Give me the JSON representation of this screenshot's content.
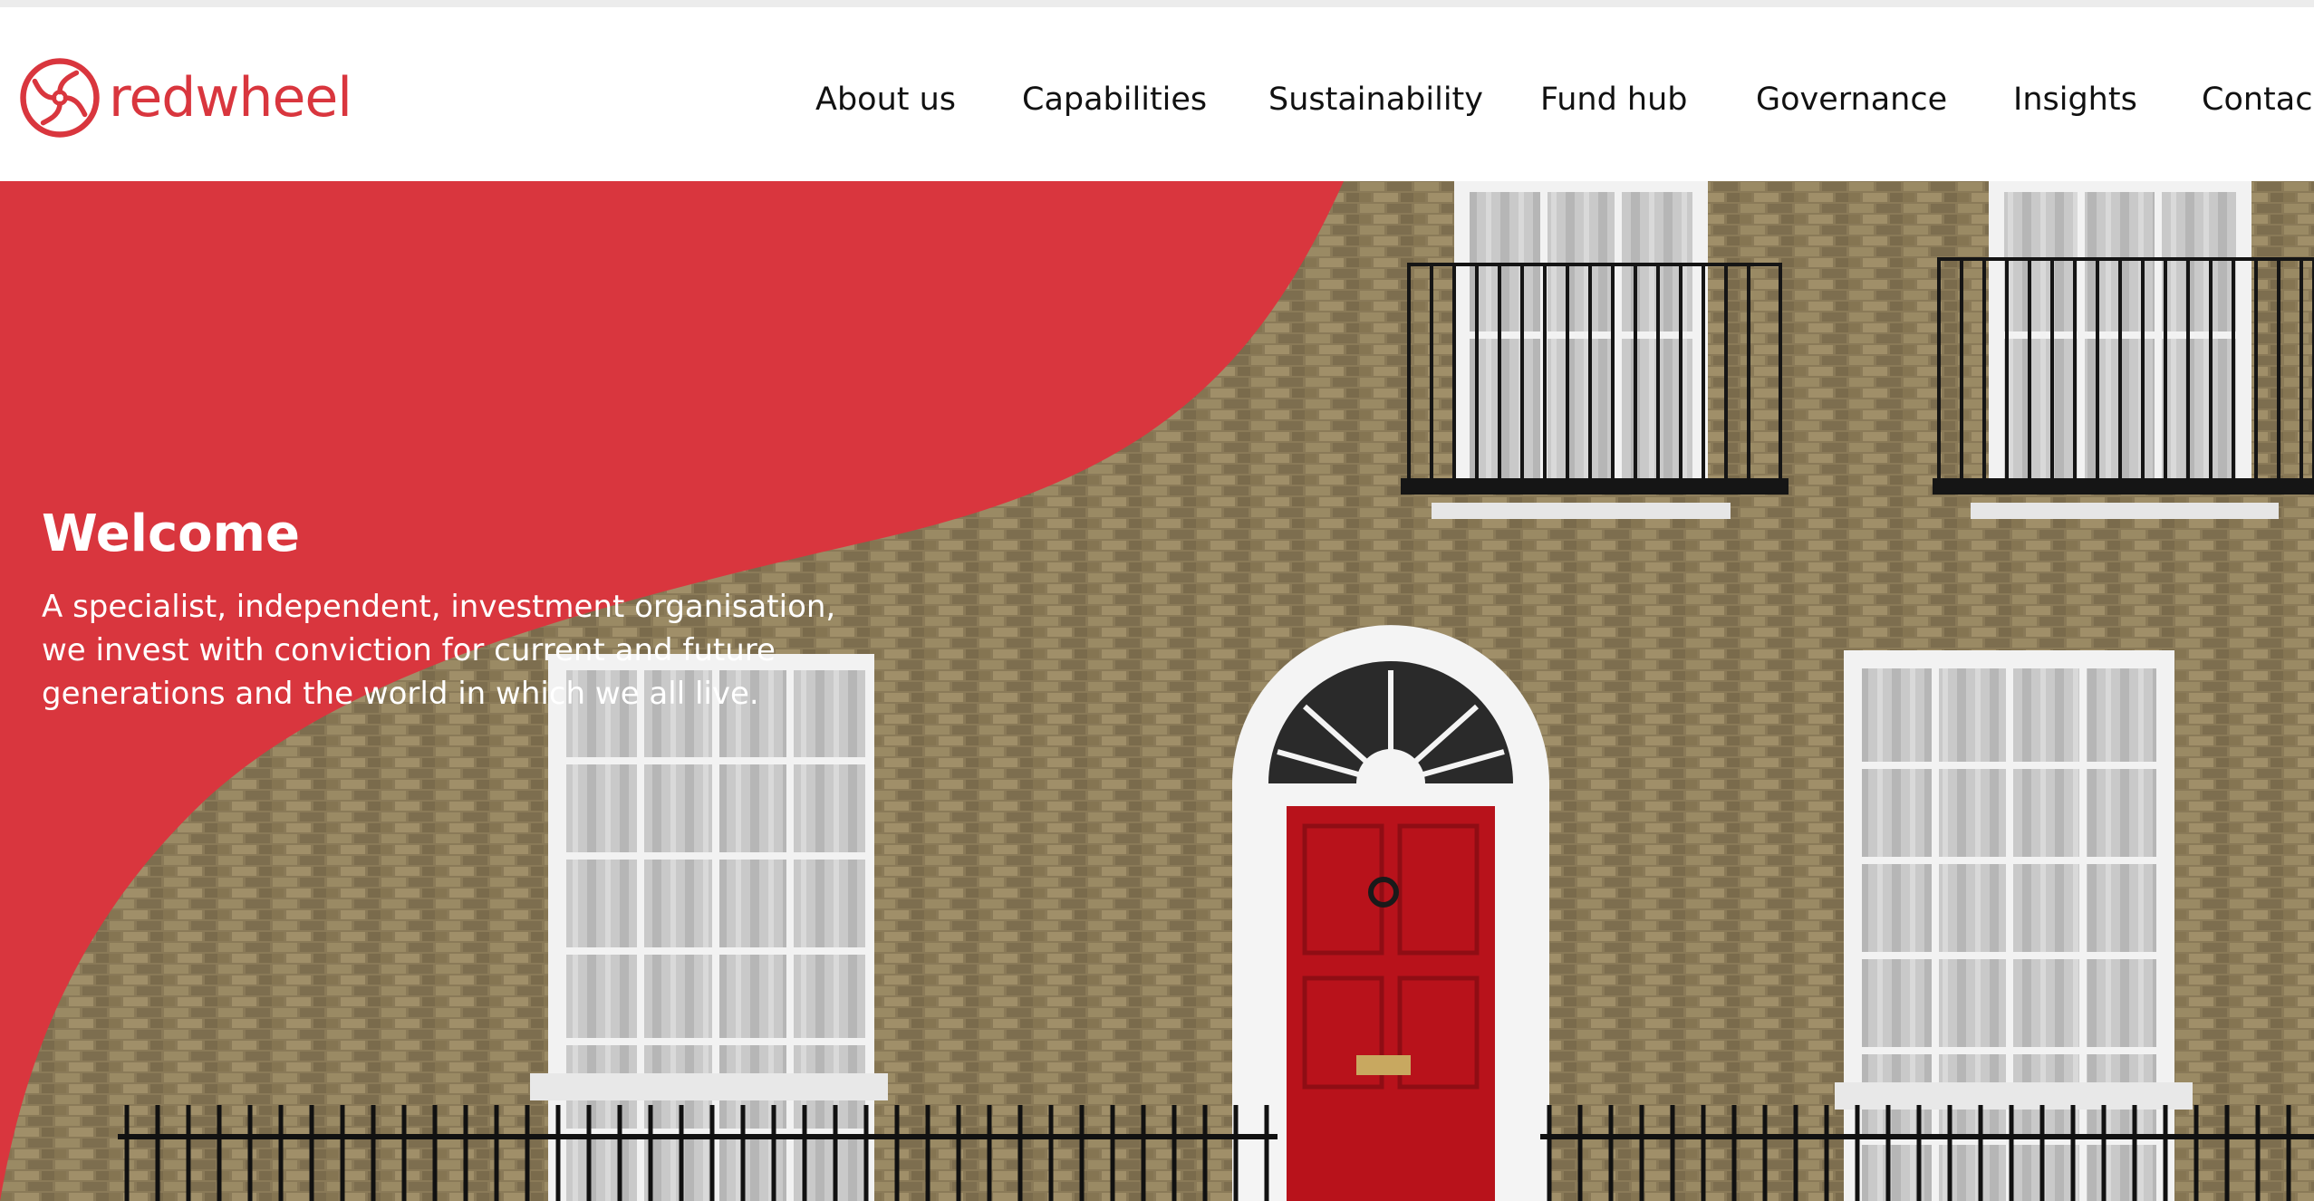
{
  "header": {
    "brand": "redwheel",
    "nav": [
      {
        "label": "About us"
      },
      {
        "label": "Capabilities"
      },
      {
        "label": "Sustainability"
      },
      {
        "label": "Fund hub"
      },
      {
        "label": "Governance"
      },
      {
        "label": "Insights"
      },
      {
        "label": "Contac"
      }
    ]
  },
  "hero": {
    "title": "Welcome",
    "body": "A specialist, independent, investment organisation, we invest with conviction for current and future generations and the world in which we all live."
  },
  "colors": {
    "brand_red": "#d9363e",
    "door_red": "#b8121b",
    "text_dark": "#111111"
  },
  "icons": {
    "logo": "redwheel-logo-icon"
  }
}
